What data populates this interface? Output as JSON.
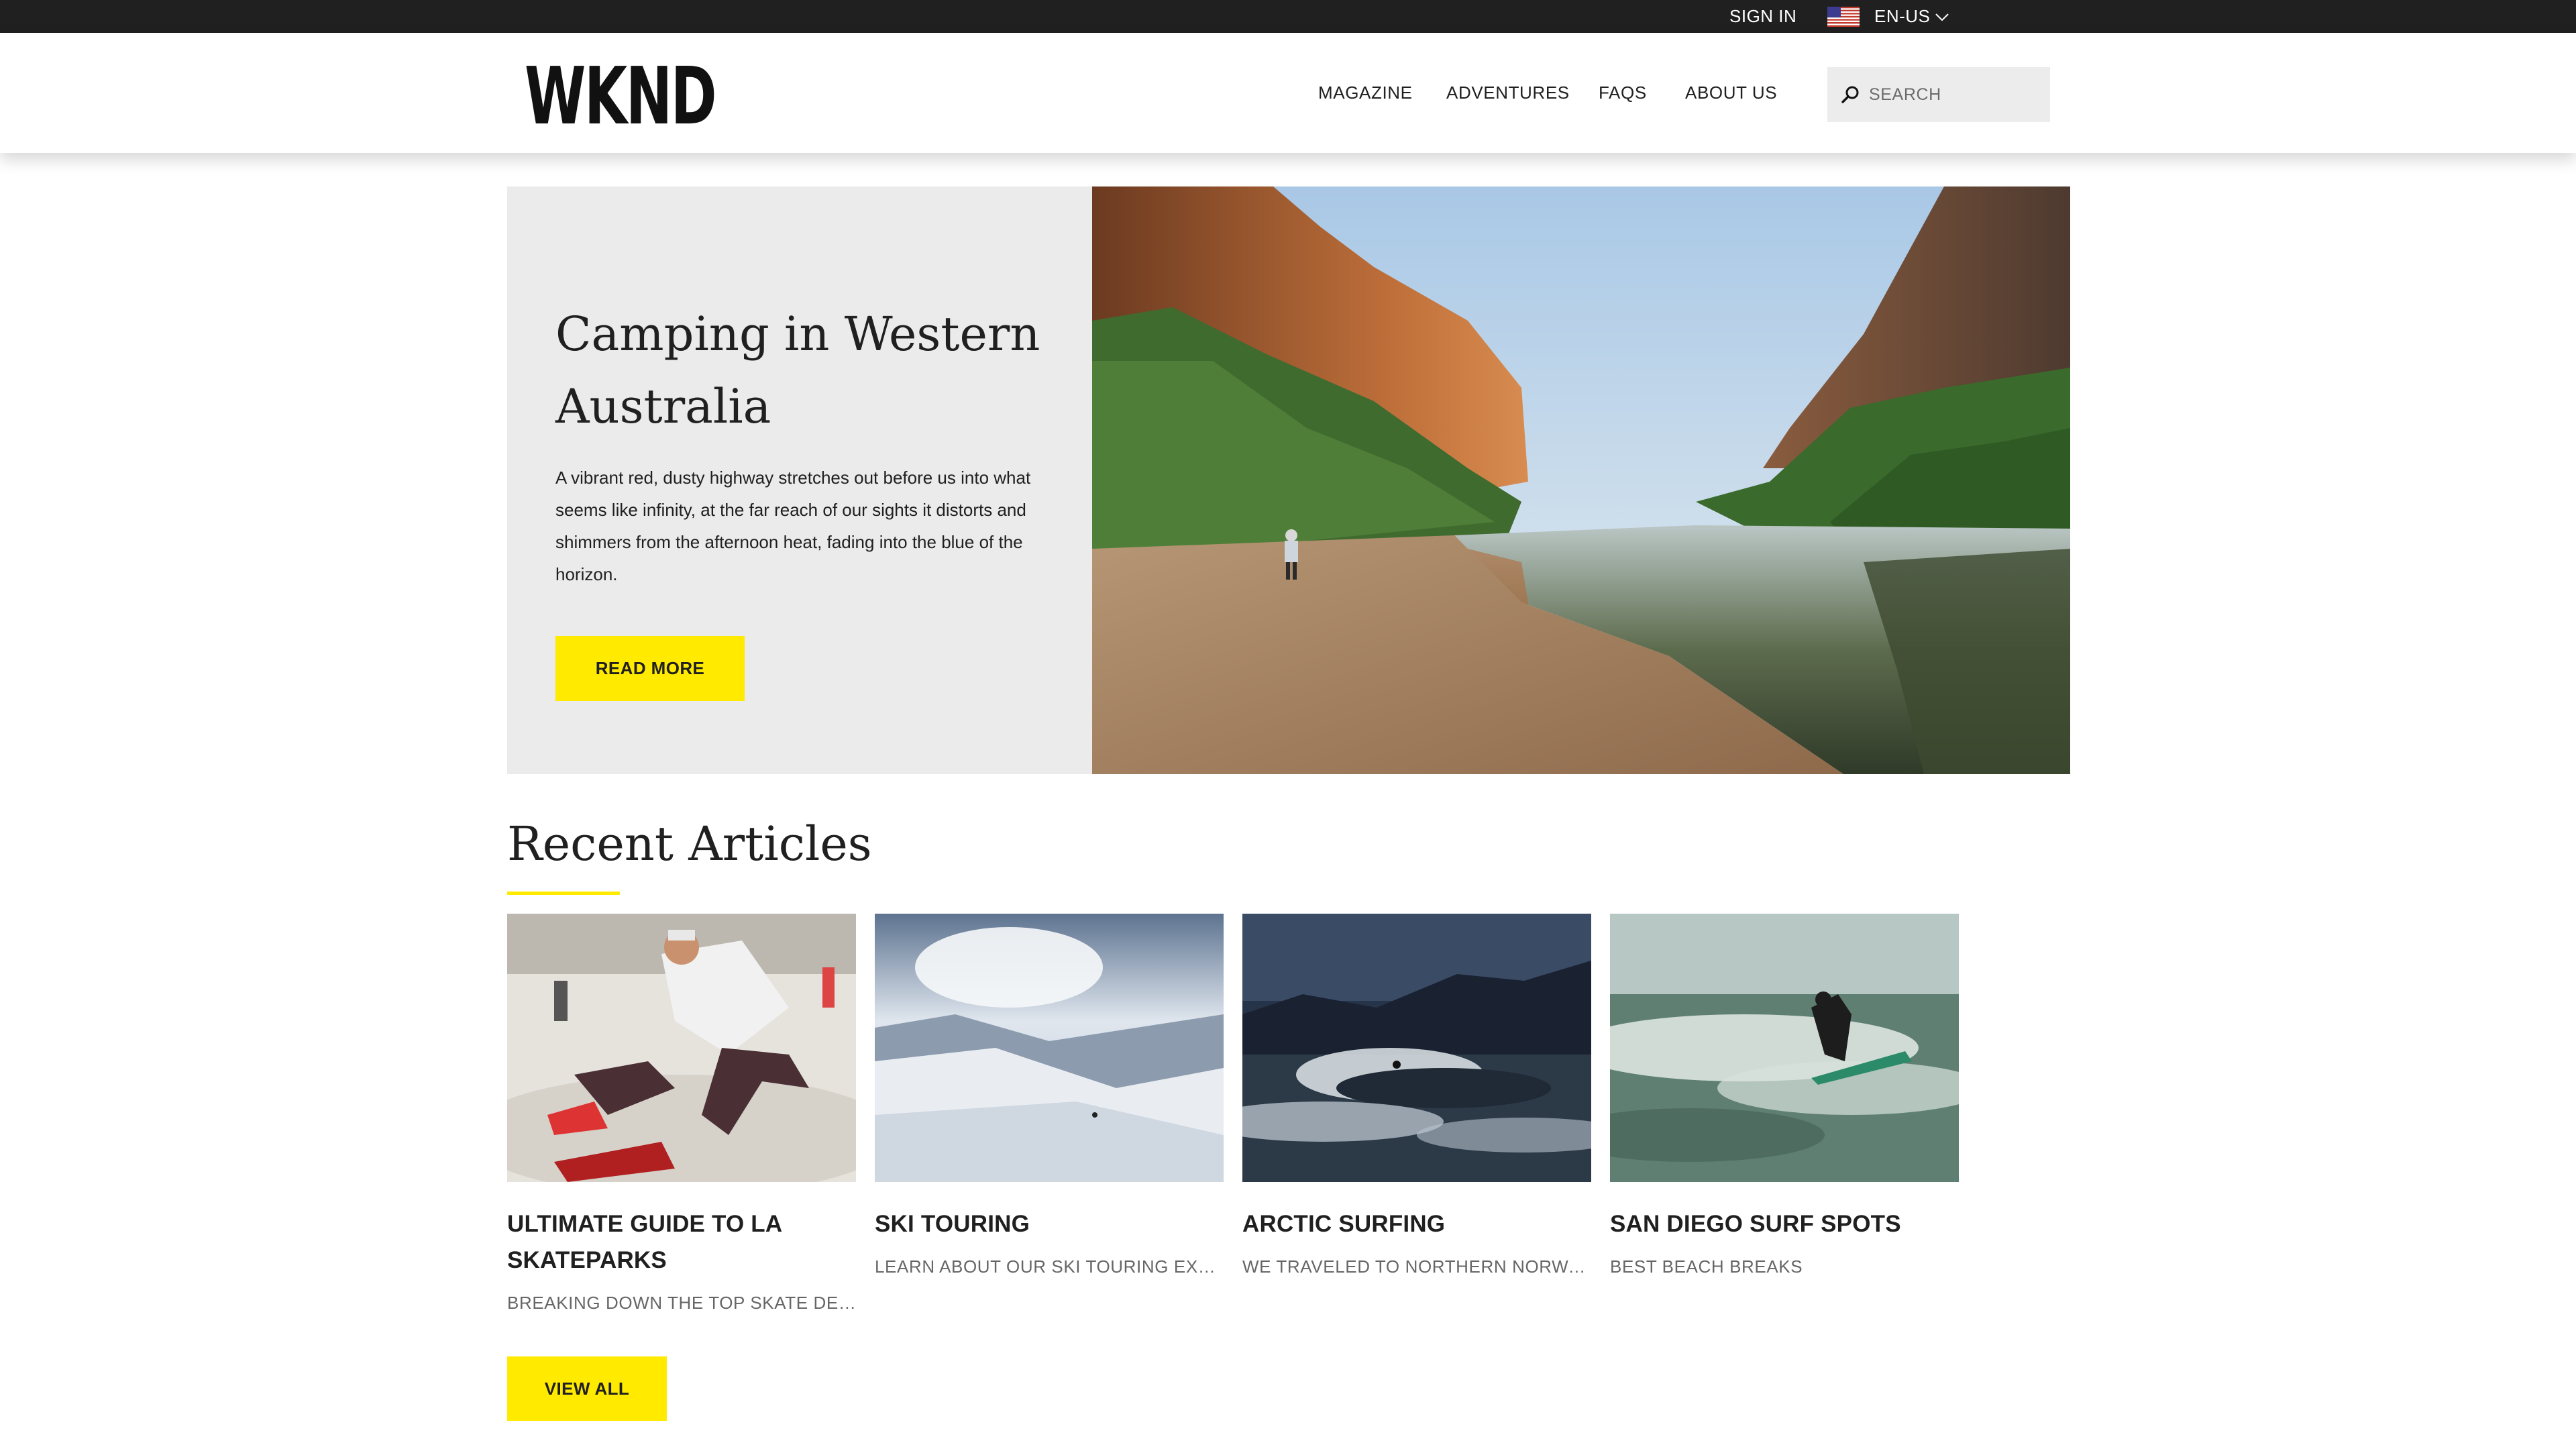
{
  "topbar": {
    "sign_in": "SIGN IN",
    "language": "EN-US",
    "flag_icon": "us-flag-icon",
    "chevron_icon": "chevron-down-icon",
    "background": "#202020"
  },
  "header": {
    "logo": "WKND",
    "nav": [
      {
        "label": "MAGAZINE"
      },
      {
        "label": "ADVENTURES"
      },
      {
        "label": "FAQS"
      },
      {
        "label": "ABOUT US"
      }
    ],
    "search": {
      "placeholder": "SEARCH",
      "icon": "search-icon"
    }
  },
  "hero": {
    "title": "Camping in Western Australia",
    "description": "A vibrant red, dusty highway stretches out before us into what seems like infinity, at the far reach of our sights it distorts and shimmers from the afternoon heat, fading into the blue of the horizon.",
    "button": "READ MORE",
    "panel_color": "#ebebeb"
  },
  "recent": {
    "title": "Recent Articles",
    "accent_color": "#ffea00",
    "articles": [
      {
        "title": "ULTIMATE GUIDE TO LA SKATEPARKS",
        "description": "BREAKING DOWN THE TOP SKATE DESTINATIONS IN LOS ANGELES"
      },
      {
        "title": "SKI TOURING",
        "description": "LEARN ABOUT OUR SKI TOURING EXPERIENCE"
      },
      {
        "title": "ARCTIC SURFING",
        "description": "WE TRAVELED TO NORTHERN NORWAY TO SURF"
      },
      {
        "title": "SAN DIEGO SURF SPOTS",
        "description": "BEST BEACH BREAKS"
      }
    ],
    "view_all": "VIEW ALL"
  }
}
